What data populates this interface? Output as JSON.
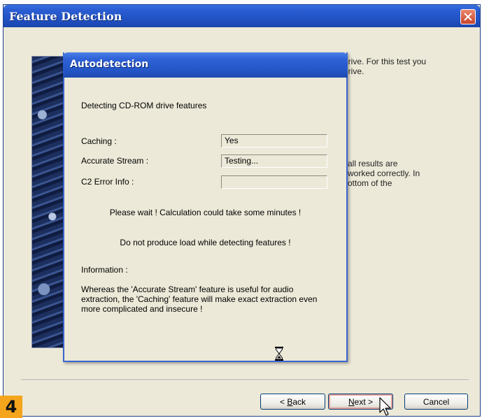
{
  "window": {
    "title": "Feature Detection",
    "close_icon": "close-icon"
  },
  "background_text": {
    "line1": "drive. For this test you",
    "line2": "drive.",
    "line3": "all results are",
    "line4": "worked correctly. In",
    "line5": "ottom of the"
  },
  "buttons": {
    "back_prefix": "< ",
    "back_key": "B",
    "back_rest": "ack",
    "next_key": "N",
    "next_rest": "ext >",
    "cancel": "Cancel"
  },
  "step_number": "4",
  "dialog": {
    "title": "Autodetection",
    "heading": "Detecting CD-ROM drive features",
    "rows": [
      {
        "label": "Caching :",
        "value": "Yes"
      },
      {
        "label": "Accurate Stream :",
        "value": "Testing..."
      },
      {
        "label": "C2 Error Info :",
        "value": ""
      }
    ],
    "wait_message": "Please wait ! Calculation could take some minutes !",
    "load_message": "Do not produce load while detecting features !",
    "info_label": "Information :",
    "info_text": "Whereas the 'Accurate Stream' feature is useful for audio extraction, the 'Caching' feature will make exact extraction even more complicated and insecure !",
    "hourglass_icon": "hourglass-icon"
  },
  "colors": {
    "title_bar": "#2456c8",
    "dialog_bg": "#ece9d8",
    "badge": "#f4a51c"
  }
}
